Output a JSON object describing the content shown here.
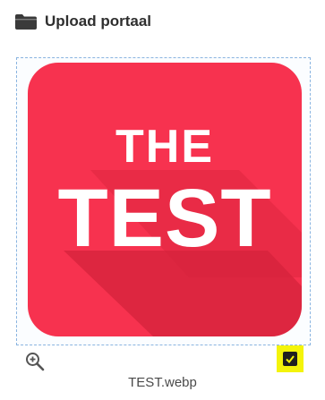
{
  "header": {
    "title": "Upload portaal",
    "icon": "folder-icon"
  },
  "preview": {
    "image_text_line1": "THE",
    "image_text_line2": "TEST",
    "background_color": "#f7324f",
    "text_color": "#ffffff"
  },
  "actions": {
    "zoom_icon": "magnifier-plus-icon",
    "select_icon": "checkbox-checked-icon",
    "select_highlight_color": "#f4f40a"
  },
  "file": {
    "name": "TEST.webp"
  }
}
